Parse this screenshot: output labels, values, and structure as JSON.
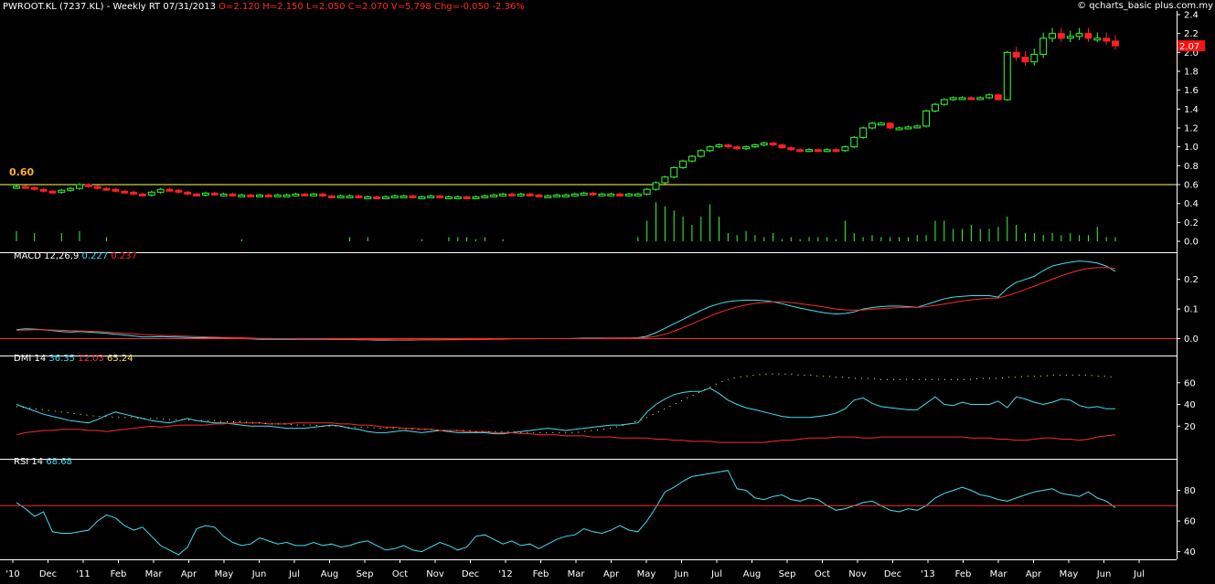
{
  "header": {
    "symbol": "PWROOT.KL (7237.KL) - Weekly RT",
    "date": "07/31/2013",
    "open": "O=2.120",
    "high": "H=2.150",
    "low": "L=2.050",
    "close": "C=2.070",
    "volume": "V=5,798",
    "change": "Chg=-0.050",
    "change_pct": "-2.36%"
  },
  "copyright": "© qcharts_basic plus.com.my",
  "colors": {
    "bg": "#000000",
    "up": "#33ff33",
    "down": "#ff2020",
    "cyan": "#40e0f0",
    "red": "#ff2a2a",
    "yellow": "#ffff66",
    "axis": "#ffffff"
  },
  "chart_data": [
    {
      "type": "candlestick",
      "panel": "price",
      "title": "PWROOT.KL (7237.KL) - Weekly RT",
      "y_ticks": [
        "2.4",
        "2.2",
        "2.0",
        "1.8",
        "1.6",
        "1.4",
        "1.2",
        "1.0",
        "0.8",
        "0.6",
        "0.4",
        "0.2",
        "0.0"
      ],
      "ylim": [
        0,
        2.4
      ],
      "last_price_label": "2.07",
      "hline": {
        "value": 0.6,
        "label": "0.60"
      },
      "close": [
        0.58,
        0.57,
        0.55,
        0.53,
        0.52,
        0.54,
        0.56,
        0.6,
        0.58,
        0.56,
        0.55,
        0.53,
        0.52,
        0.5,
        0.49,
        0.52,
        0.55,
        0.54,
        0.52,
        0.5,
        0.49,
        0.51,
        0.5,
        0.5,
        0.49,
        0.49,
        0.48,
        0.49,
        0.48,
        0.49,
        0.49,
        0.5,
        0.49,
        0.5,
        0.48,
        0.47,
        0.48,
        0.48,
        0.47,
        0.47,
        0.46,
        0.47,
        0.48,
        0.48,
        0.47,
        0.47,
        0.48,
        0.47,
        0.47,
        0.47,
        0.46,
        0.47,
        0.48,
        0.49,
        0.5,
        0.49,
        0.5,
        0.49,
        0.48,
        0.48,
        0.49,
        0.49,
        0.5,
        0.51,
        0.5,
        0.5,
        0.5,
        0.49,
        0.5,
        0.5,
        0.55,
        0.62,
        0.68,
        0.78,
        0.85,
        0.9,
        0.96,
        1.0,
        1.02,
        1.0,
        0.98,
        1.0,
        1.02,
        1.04,
        1.02,
        0.99,
        0.97,
        0.96,
        0.97,
        0.96,
        0.97,
        0.96,
        1.0,
        1.1,
        1.2,
        1.25,
        1.25,
        1.2,
        1.2,
        1.21,
        1.22,
        1.38,
        1.45,
        1.5,
        1.52,
        1.52,
        1.51,
        1.52,
        1.55,
        1.5,
        2.0,
        1.95,
        1.9,
        1.98,
        2.15,
        2.2,
        2.15,
        2.17,
        2.2,
        2.15,
        2.15,
        2.12,
        2.07
      ],
      "volume_relative": [
        0.25,
        0.0,
        0.2,
        0.0,
        0.0,
        0.2,
        0.0,
        0.25,
        0.0,
        0.0,
        0.1,
        0.0,
        0.0,
        0.0,
        0.0,
        0.0,
        0.0,
        0.0,
        0.0,
        0.0,
        0.0,
        0.0,
        0.0,
        0.0,
        0.0,
        0.05,
        0.0,
        0.0,
        0.0,
        0.0,
        0.0,
        0.0,
        0.0,
        0.0,
        0.0,
        0.0,
        0.0,
        0.1,
        0.0,
        0.1,
        0.0,
        0.0,
        0.0,
        0.0,
        0.0,
        0.05,
        0.0,
        0.0,
        0.1,
        0.1,
        0.1,
        0.05,
        0.1,
        0.0,
        0.05,
        0.0,
        0.0,
        0.0,
        0.0,
        0.0,
        0.0,
        0.0,
        0.0,
        0.0,
        0.0,
        0.0,
        0.0,
        0.0,
        0.0,
        0.1,
        0.5,
        0.95,
        0.85,
        0.75,
        0.6,
        0.4,
        0.6,
        0.9,
        0.6,
        0.2,
        0.15,
        0.25,
        0.15,
        0.1,
        0.2,
        0.05,
        0.1,
        0.05,
        0.1,
        0.1,
        0.1,
        0.05,
        0.5,
        0.2,
        0.1,
        0.15,
        0.1,
        0.1,
        0.1,
        0.1,
        0.15,
        0.15,
        0.5,
        0.5,
        0.3,
        0.3,
        0.4,
        0.3,
        0.3,
        0.35,
        0.6,
        0.4,
        0.2,
        0.2,
        0.15,
        0.2,
        0.15,
        0.2,
        0.15,
        0.15,
        0.35,
        0.1,
        0.1
      ]
    },
    {
      "type": "line",
      "panel": "macd",
      "title": "MACD 12,26,9",
      "y_ticks": [
        "0.2",
        "0.1",
        "0.0"
      ],
      "ylim": [
        -0.02,
        0.27
      ],
      "series": [
        {
          "name": "0.227",
          "color": "#40e0f0",
          "values": [
            0.03,
            0.033,
            0.032,
            0.03,
            0.027,
            0.024,
            0.022,
            0.024,
            0.022,
            0.02,
            0.018,
            0.015,
            0.012,
            0.009,
            0.006,
            0.006,
            0.007,
            0.006,
            0.005,
            0.004,
            0.003,
            0.003,
            0.002,
            0.002,
            0.001,
            0.0,
            -0.001,
            -0.002,
            -0.002,
            -0.002,
            -0.002,
            -0.002,
            -0.002,
            -0.002,
            -0.002,
            -0.003,
            -0.003,
            -0.003,
            -0.004,
            -0.004,
            -0.005,
            -0.005,
            -0.005,
            -0.005,
            -0.005,
            -0.004,
            -0.004,
            -0.004,
            -0.003,
            -0.003,
            -0.003,
            -0.003,
            -0.002,
            -0.001,
            0.0,
            0.0,
            0.0,
            0.0,
            0.0,
            0.0,
            0.0,
            0.0,
            0.001,
            0.002,
            0.002,
            0.002,
            0.002,
            0.002,
            0.002,
            0.003,
            0.008,
            0.02,
            0.035,
            0.05,
            0.065,
            0.08,
            0.095,
            0.108,
            0.118,
            0.125,
            0.128,
            0.13,
            0.13,
            0.128,
            0.124,
            0.118,
            0.11,
            0.103,
            0.097,
            0.091,
            0.086,
            0.083,
            0.085,
            0.09,
            0.1,
            0.105,
            0.108,
            0.11,
            0.11,
            0.108,
            0.106,
            0.115,
            0.125,
            0.135,
            0.14,
            0.143,
            0.145,
            0.145,
            0.145,
            0.14,
            0.17,
            0.19,
            0.2,
            0.21,
            0.23,
            0.245,
            0.252,
            0.258,
            0.262,
            0.26,
            0.255,
            0.245,
            0.227
          ]
        },
        {
          "name": "0.237",
          "color": "#ff2a2a",
          "values": [
            0.028,
            0.029,
            0.03,
            0.03,
            0.029,
            0.028,
            0.027,
            0.026,
            0.025,
            0.024,
            0.022,
            0.02,
            0.018,
            0.016,
            0.014,
            0.012,
            0.011,
            0.01,
            0.009,
            0.008,
            0.007,
            0.006,
            0.005,
            0.004,
            0.004,
            0.003,
            0.002,
            0.001,
            0.001,
            0.0,
            0.0,
            -0.001,
            -0.001,
            -0.001,
            -0.001,
            -0.002,
            -0.002,
            -0.002,
            -0.002,
            -0.003,
            -0.003,
            -0.003,
            -0.004,
            -0.004,
            -0.004,
            -0.004,
            -0.004,
            -0.004,
            -0.004,
            -0.004,
            -0.003,
            -0.003,
            -0.003,
            -0.002,
            -0.002,
            -0.001,
            -0.001,
            -0.001,
            0.0,
            0.0,
            0.0,
            0.0,
            0.0,
            0.001,
            0.001,
            0.001,
            0.002,
            0.002,
            0.002,
            0.002,
            0.004,
            0.008,
            0.015,
            0.025,
            0.037,
            0.05,
            0.063,
            0.076,
            0.088,
            0.098,
            0.107,
            0.114,
            0.119,
            0.122,
            0.124,
            0.124,
            0.122,
            0.118,
            0.114,
            0.11,
            0.105,
            0.1,
            0.097,
            0.096,
            0.097,
            0.099,
            0.101,
            0.103,
            0.105,
            0.106,
            0.106,
            0.108,
            0.112,
            0.117,
            0.122,
            0.127,
            0.131,
            0.134,
            0.136,
            0.137,
            0.145,
            0.155,
            0.166,
            0.177,
            0.189,
            0.201,
            0.212,
            0.222,
            0.231,
            0.237,
            0.24,
            0.24,
            0.237
          ]
        }
      ]
    },
    {
      "type": "line",
      "panel": "dmi",
      "title": "DMI 14",
      "y_ticks": [
        "60",
        "40",
        "20"
      ],
      "ylim": [
        0,
        80
      ],
      "series": [
        {
          "name": "36.35",
          "color": "#40e0f0",
          "values": [
            40,
            37,
            34,
            31,
            29,
            27,
            25,
            24,
            23,
            26,
            30,
            33,
            31,
            29,
            27,
            25,
            24,
            23,
            25,
            27,
            25,
            24,
            23,
            23,
            22,
            21,
            20,
            20,
            20,
            19,
            18,
            18,
            18,
            19,
            20,
            21,
            20,
            18,
            17,
            15,
            14,
            14,
            15,
            16,
            15,
            14,
            15,
            16,
            15,
            14,
            14,
            14,
            14,
            13,
            13,
            14,
            15,
            16,
            17,
            18,
            17,
            16,
            17,
            18,
            19,
            20,
            21,
            21,
            22,
            23,
            33,
            40,
            45,
            49,
            51,
            52,
            52,
            55,
            50,
            44,
            40,
            37,
            35,
            33,
            31,
            29,
            28,
            28,
            28,
            29,
            30,
            32,
            36,
            44,
            46,
            41,
            38,
            37,
            36,
            35,
            35,
            41,
            47,
            40,
            39,
            42,
            40,
            40,
            40,
            43,
            37,
            47,
            45,
            42,
            40,
            42,
            45,
            44,
            39,
            37,
            38,
            36,
            36
          ]
        },
        {
          "name": "12.03",
          "color": "#ff2a2a",
          "values": [
            12,
            14,
            15,
            16,
            16,
            17,
            17,
            17,
            16,
            16,
            15,
            16,
            17,
            18,
            19,
            20,
            19,
            20,
            21,
            21,
            21,
            21,
            22,
            22,
            23,
            23,
            23,
            23,
            22,
            22,
            22,
            23,
            23,
            23,
            23,
            23,
            22,
            22,
            21,
            21,
            20,
            19,
            19,
            18,
            18,
            17,
            17,
            16,
            16,
            16,
            15,
            15,
            15,
            14,
            14,
            14,
            13,
            13,
            12,
            12,
            12,
            11,
            11,
            11,
            10,
            10,
            10,
            9,
            9,
            9,
            9,
            8,
            8,
            7,
            7,
            6,
            6,
            6,
            5,
            5,
            5,
            5,
            5,
            5,
            6,
            7,
            7,
            8,
            9,
            9,
            9,
            10,
            10,
            10,
            9,
            9,
            10,
            10,
            10,
            10,
            10,
            10,
            10,
            10,
            10,
            10,
            9,
            9,
            9,
            8,
            8,
            7,
            7,
            8,
            9,
            9,
            8,
            8,
            7,
            8,
            10,
            11,
            12
          ]
        },
        {
          "name": "65.24",
          "color": "#ffff66",
          "values": [
            38,
            37,
            36,
            35,
            34,
            33,
            32,
            31,
            30,
            29,
            29,
            28,
            28,
            28,
            27,
            27,
            27,
            26,
            26,
            26,
            25,
            25,
            25,
            24,
            24,
            24,
            23,
            23,
            22,
            22,
            22,
            21,
            21,
            21,
            20,
            20,
            20,
            19,
            19,
            19,
            18,
            18,
            18,
            17,
            17,
            17,
            17,
            16,
            16,
            16,
            16,
            15,
            15,
            15,
            15,
            15,
            14,
            14,
            14,
            14,
            14,
            14,
            14,
            15,
            16,
            17,
            18,
            20,
            22,
            25,
            28,
            32,
            36,
            40,
            44,
            48,
            52,
            56,
            60,
            63,
            65,
            66,
            67,
            68,
            68,
            68,
            68,
            67,
            67,
            66,
            66,
            65,
            65,
            64,
            64,
            64,
            63,
            63,
            63,
            63,
            63,
            63,
            63,
            63,
            63,
            63,
            63,
            64,
            64,
            64,
            65,
            65,
            66,
            66,
            66,
            67,
            67,
            67,
            67,
            67,
            66,
            66,
            65
          ]
        }
      ]
    },
    {
      "type": "line",
      "panel": "rsi",
      "title": "RSI 14",
      "y_ticks": [
        "80",
        "60",
        "40"
      ],
      "ylim": [
        35,
        97
      ],
      "hline": 70,
      "series": [
        {
          "name": "68.68",
          "color": "#40e0f0",
          "values": [
            72,
            68,
            63,
            66,
            53,
            52,
            52,
            53,
            54,
            60,
            64,
            62,
            57,
            54,
            56,
            50,
            44,
            41,
            38,
            43,
            55,
            57,
            56,
            50,
            46,
            44,
            45,
            49,
            47,
            45,
            46,
            44,
            44,
            46,
            44,
            45,
            43,
            44,
            46,
            47,
            44,
            41,
            42,
            44,
            41,
            40,
            43,
            46,
            44,
            41,
            43,
            50,
            51,
            48,
            45,
            47,
            44,
            45,
            42,
            45,
            48,
            50,
            51,
            55,
            53,
            52,
            54,
            57,
            54,
            53,
            60,
            69,
            79,
            82,
            86,
            89,
            90,
            91,
            92,
            93,
            81,
            80,
            75,
            74,
            76,
            77,
            74,
            73,
            75,
            74,
            70,
            67,
            68,
            70,
            72,
            73,
            70,
            67,
            66,
            68,
            67,
            70,
            75,
            78,
            80,
            82,
            80,
            77,
            76,
            74,
            73,
            75,
            77,
            79,
            80,
            81,
            78,
            77,
            76,
            79,
            75,
            73,
            68.68
          ]
        }
      ]
    }
  ],
  "x_axis": {
    "months": [
      "'10",
      "Dec",
      "'11",
      "Feb",
      "Mar",
      "Apr",
      "May",
      "Jun",
      "Jul",
      "Aug",
      "Sep",
      "Oct",
      "Nov",
      "Dec",
      "'12",
      "Feb",
      "Mar",
      "Apr",
      "May",
      "Jun",
      "Jul",
      "Aug",
      "Sep",
      "Oct",
      "Nov",
      "Dec",
      "'13",
      "Feb",
      "Mar",
      "Apr",
      "May",
      "Jun",
      "Jul"
    ]
  }
}
